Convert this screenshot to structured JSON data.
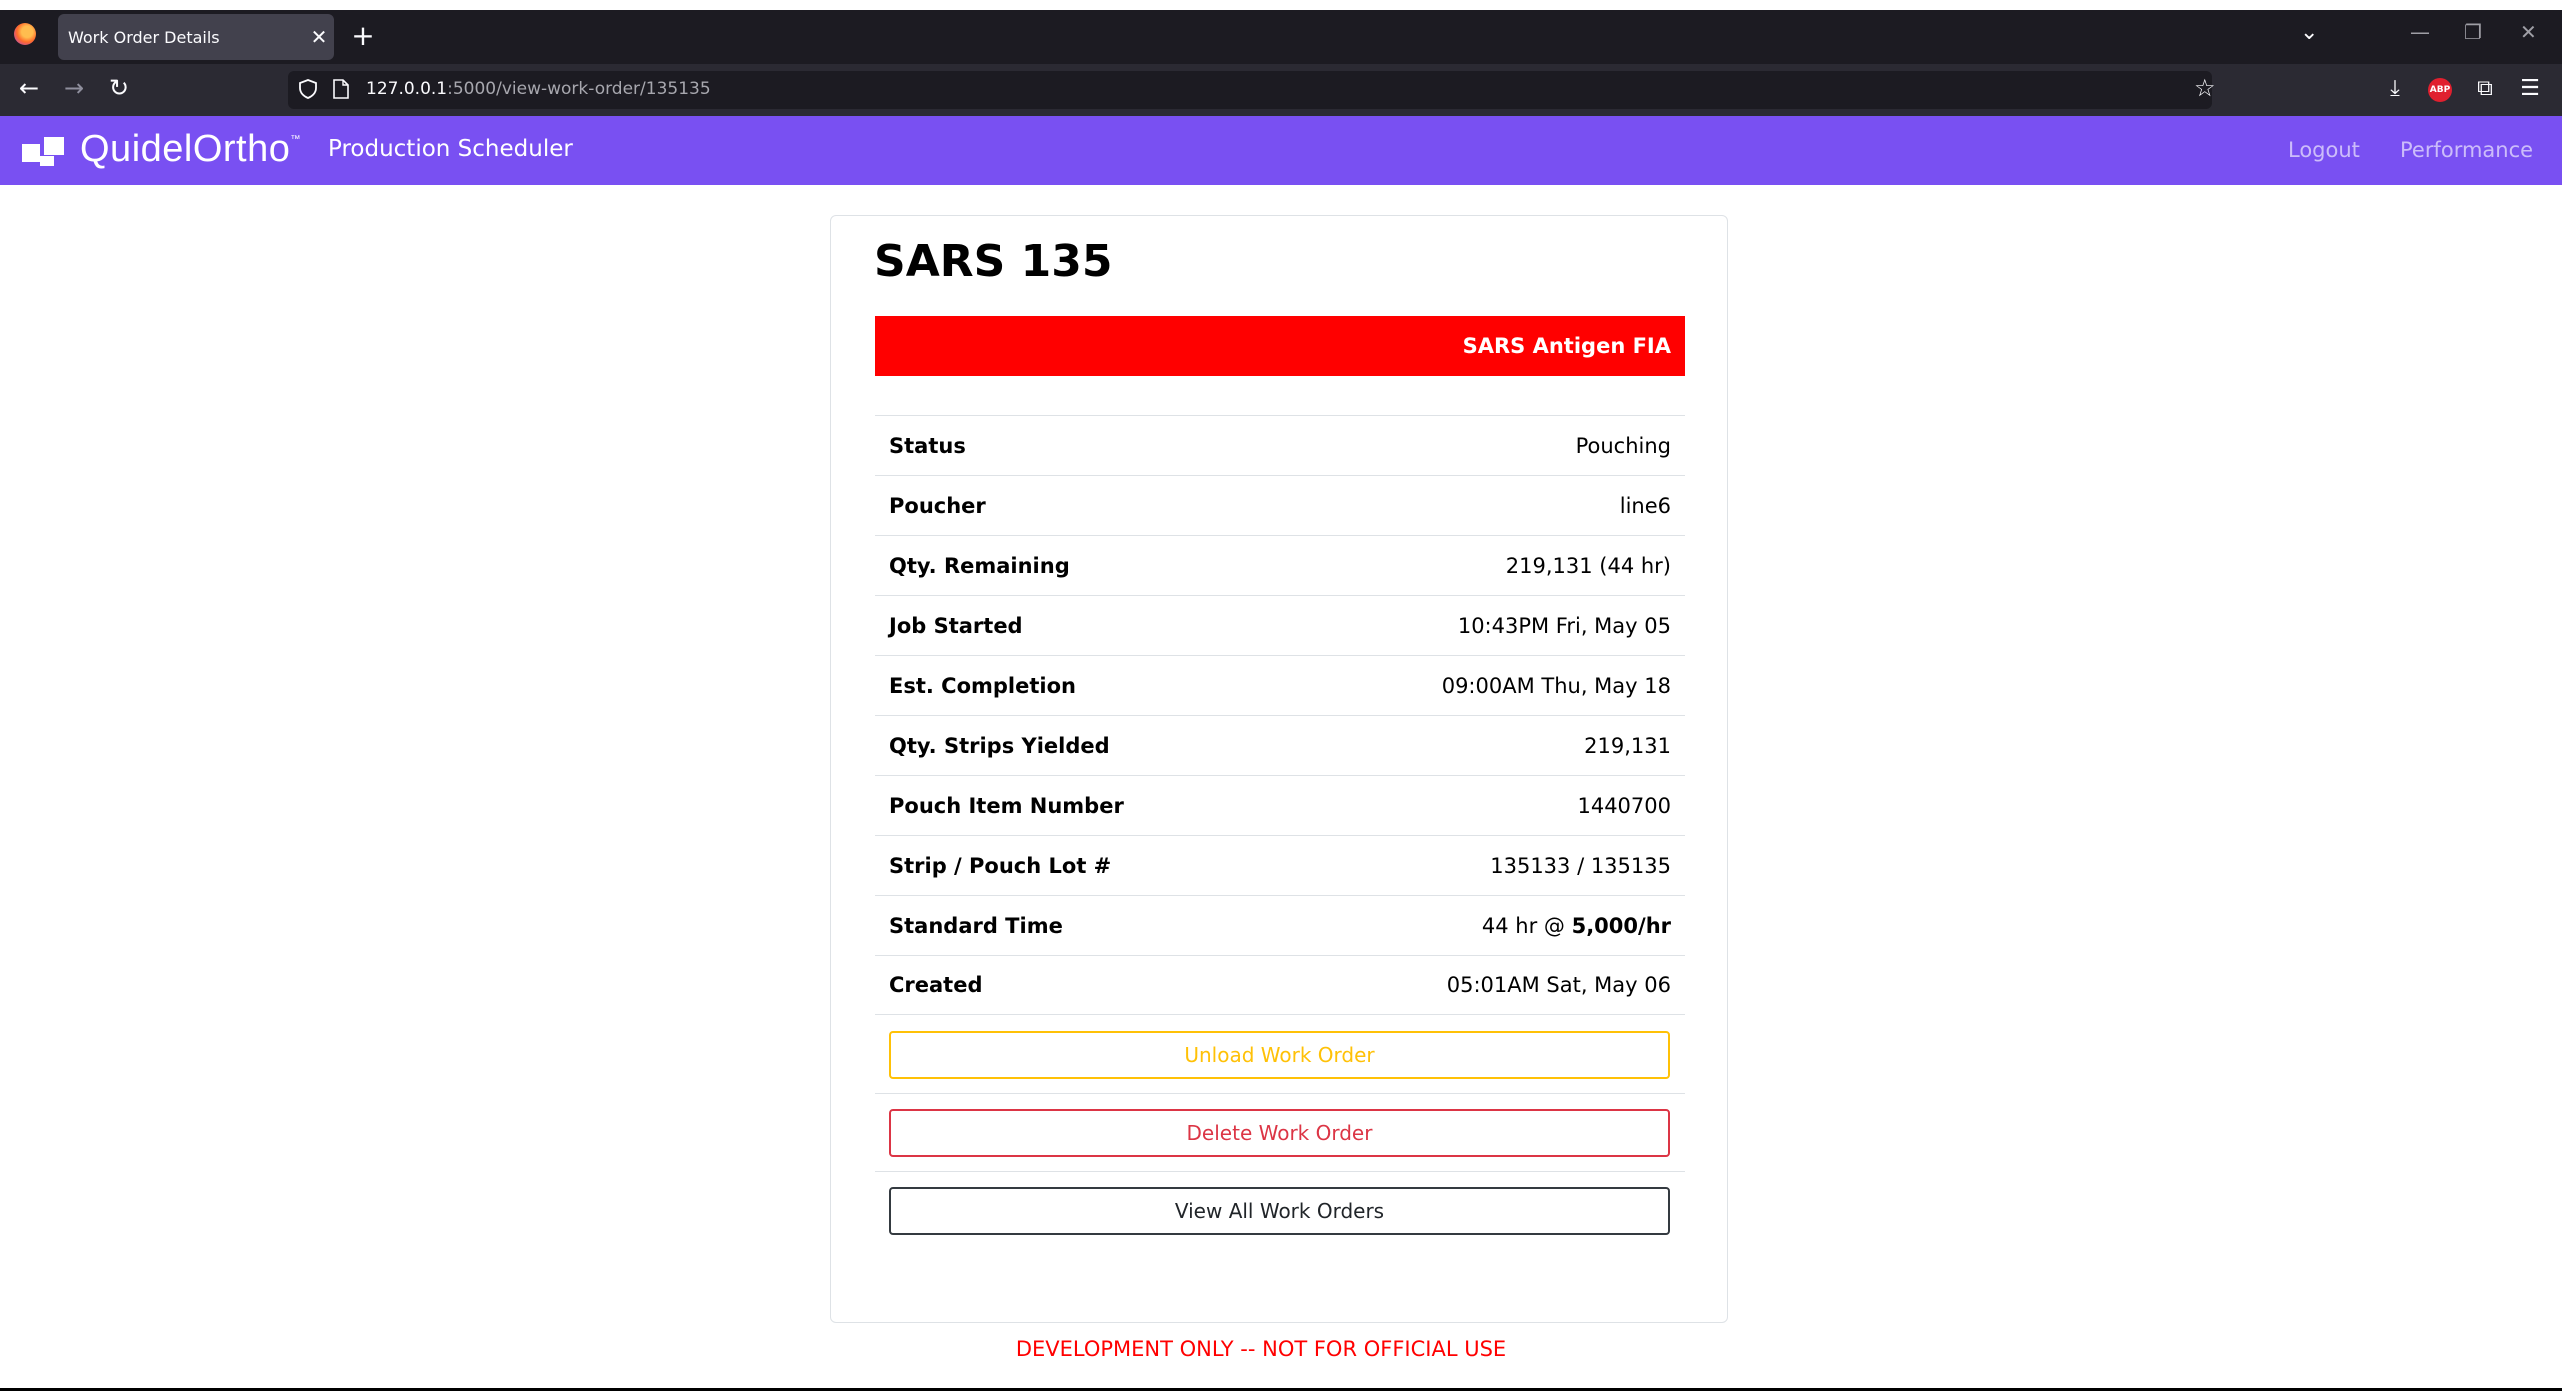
{
  "browser": {
    "tab_title": "Work Order Details",
    "tab_close": "✕",
    "new_tab": "+",
    "url_host": "127.0.0.1",
    "url_rest": ":5000/view-work-order/135135",
    "extension_label": "ABP"
  },
  "navbar": {
    "brand": "QuidelOrtho",
    "brand_tm": "™",
    "app_title": "Production Scheduler",
    "links": [
      "Logout",
      "Performance"
    ],
    "bg_color": "#7950f2"
  },
  "work_order": {
    "title": "SARS 135",
    "product": "SARS Antigen FIA",
    "product_color": "#ff0000",
    "details": [
      {
        "label": "Status",
        "value": "Pouching"
      },
      {
        "label": "Poucher",
        "value": "line6"
      },
      {
        "label": "Qty. Remaining",
        "value": "219,131 (44 hr)"
      },
      {
        "label": "Job Started",
        "value": "10:43PM Fri, May 05"
      },
      {
        "label": "Est. Completion",
        "value": "09:00AM Thu, May 18"
      },
      {
        "label": "Qty. Strips Yielded",
        "value": "219,131"
      },
      {
        "label": "Pouch Item Number",
        "value": "1440700"
      },
      {
        "label": "Strip / Pouch Lot #",
        "value": "135133 / 135135"
      },
      {
        "label": "Standard Time",
        "value_prefix": "44 hr @ ",
        "value_bold": "5,000/hr"
      },
      {
        "label": "Created",
        "value": "05:01AM Sat, May 06"
      }
    ],
    "buttons": {
      "unload": "Unload Work Order",
      "delete": "Delete Work Order",
      "view_all": "View All Work Orders"
    }
  },
  "footer": {
    "dev_notice": "DEVELOPMENT ONLY -- NOT FOR OFFICIAL USE"
  }
}
